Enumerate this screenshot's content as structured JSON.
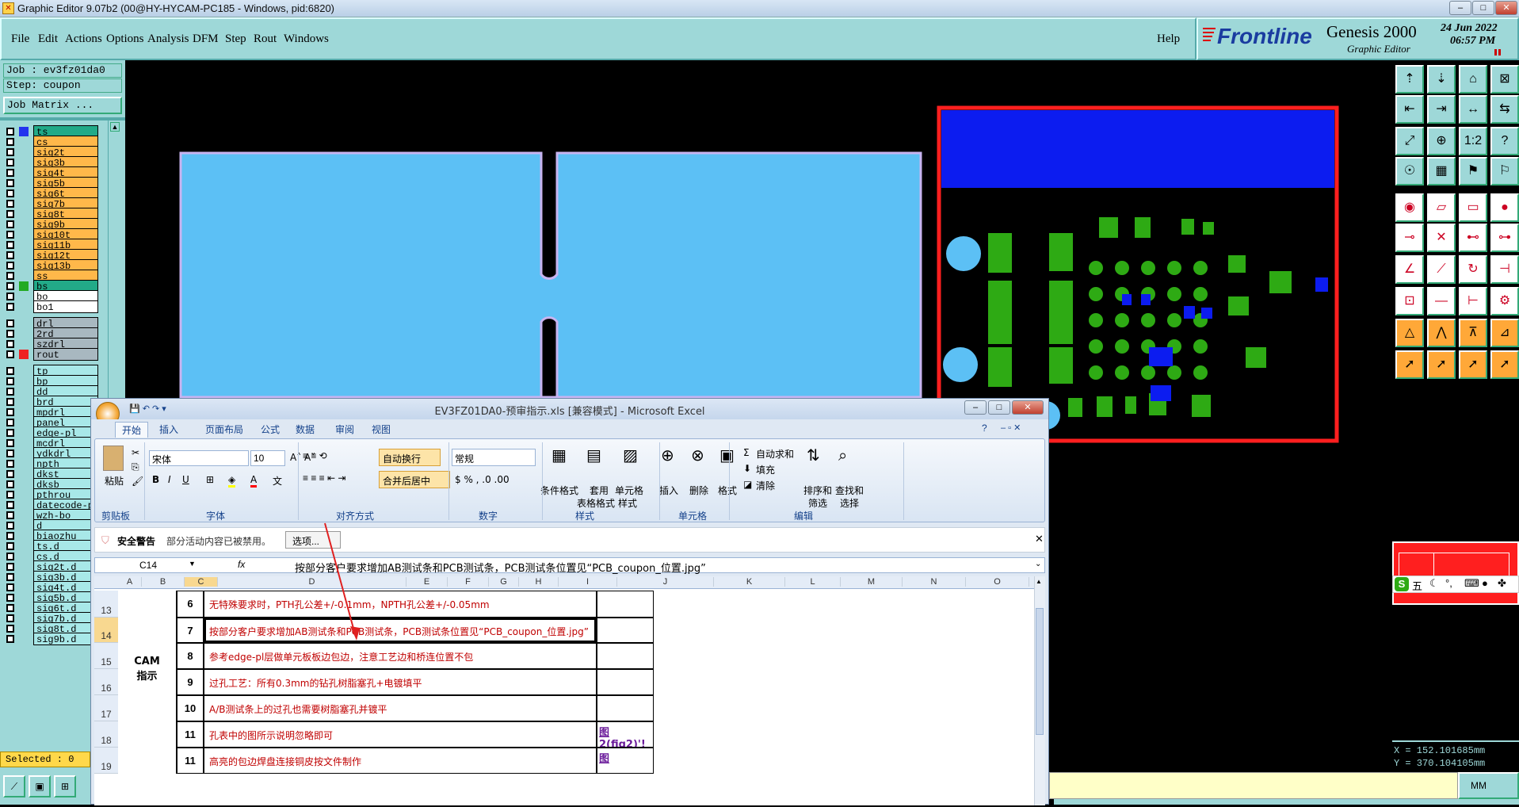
{
  "window": {
    "title": "Graphic Editor 9.07b2 (00@HY-HYCAM-PC185 - Windows, pid:6820)"
  },
  "menu": {
    "items": [
      "File",
      "Edit",
      "Actions",
      "Options",
      "Analysis",
      "DFM",
      "Step",
      "Rout",
      "Windows"
    ],
    "help": "Help"
  },
  "logo": {
    "brand": "Frontline",
    "product": "Genesis 2000",
    "sub": "Graphic Editor",
    "date": "24 Jun 2022",
    "time": "06:57 PM"
  },
  "job": {
    "job_label": "Job : ev3fz01da0",
    "step_label": "Step: coupon",
    "matrix_button": "Job Matrix ..."
  },
  "layers": [
    {
      "name": "ts",
      "color": "#2233ee",
      "bg": "#22aa88"
    },
    {
      "name": "cs",
      "color": "",
      "bg": "#ffb84a"
    },
    {
      "name": "sig2t",
      "color": "",
      "bg": "#ffb84a"
    },
    {
      "name": "sig3b",
      "color": "",
      "bg": "#ffb84a"
    },
    {
      "name": "sig4t",
      "color": "",
      "bg": "#ffb84a"
    },
    {
      "name": "sig5b",
      "color": "",
      "bg": "#ffb84a"
    },
    {
      "name": "sig6t",
      "color": "",
      "bg": "#ffb84a"
    },
    {
      "name": "sig7b",
      "color": "",
      "bg": "#ffb84a"
    },
    {
      "name": "sig8t",
      "color": "",
      "bg": "#ffb84a"
    },
    {
      "name": "sig9b",
      "color": "",
      "bg": "#ffb84a"
    },
    {
      "name": "sig10t",
      "color": "",
      "bg": "#ffb84a"
    },
    {
      "name": "sig11b",
      "color": "",
      "bg": "#ffb84a"
    },
    {
      "name": "sig12t",
      "color": "",
      "bg": "#ffb84a"
    },
    {
      "name": "sig13b",
      "color": "",
      "bg": "#ffb84a"
    },
    {
      "name": "ss",
      "color": "",
      "bg": "#ffb84a"
    },
    {
      "name": "bs",
      "color": "#22aa22",
      "bg": "#22aa88"
    },
    {
      "name": "bo",
      "color": "",
      "bg": "#ffffff"
    },
    {
      "name": "bo1",
      "color": "",
      "bg": "#ffffff"
    },
    {
      "name": "drl",
      "color": "",
      "bg": "#a8b8c0"
    },
    {
      "name": "2rd",
      "color": "",
      "bg": "#a8b8c0"
    },
    {
      "name": "szdrl",
      "color": "",
      "bg": "#a8b8c0"
    },
    {
      "name": "rout",
      "color": "#ee2222",
      "bg": "#a8b8c0"
    },
    {
      "name": "tp",
      "color": "",
      "bg": "#a8e8e8"
    },
    {
      "name": "bp",
      "color": "",
      "bg": "#a8e8e8"
    },
    {
      "name": "dd",
      "color": "",
      "bg": "#a8e8e8"
    },
    {
      "name": "brd",
      "color": "",
      "bg": "#a8e8e8"
    },
    {
      "name": "mpdrl",
      "color": "",
      "bg": "#a8e8e8"
    },
    {
      "name": "panel",
      "color": "",
      "bg": "#a8e8e8"
    },
    {
      "name": "edge-pl",
      "color": "",
      "bg": "#a8e8e8"
    },
    {
      "name": "mcdrl",
      "color": "",
      "bg": "#a8e8e8"
    },
    {
      "name": "ydkdrl",
      "color": "",
      "bg": "#a8e8e8"
    },
    {
      "name": "npth",
      "color": "",
      "bg": "#a8e8e8"
    },
    {
      "name": "dkst",
      "color": "",
      "bg": "#a8e8e8"
    },
    {
      "name": "dksb",
      "color": "",
      "bg": "#a8e8e8"
    },
    {
      "name": "pthrou",
      "color": "",
      "bg": "#a8e8e8"
    },
    {
      "name": "datecode-p",
      "color": "",
      "bg": "#a8e8e8"
    },
    {
      "name": "wzh-bo",
      "color": "",
      "bg": "#a8e8e8"
    },
    {
      "name": "d",
      "color": "",
      "bg": "#a8e8e8"
    },
    {
      "name": "biaozhu",
      "color": "",
      "bg": "#a8e8e8"
    },
    {
      "name": "ts.d",
      "color": "",
      "bg": "#a8e8e8"
    },
    {
      "name": "cs.d",
      "color": "",
      "bg": "#a8e8e8"
    },
    {
      "name": "sig2t.d",
      "color": "",
      "bg": "#a8e8e8"
    },
    {
      "name": "sig3b.d",
      "color": "",
      "bg": "#a8e8e8"
    },
    {
      "name": "sig4t.d",
      "color": "",
      "bg": "#a8e8e8"
    },
    {
      "name": "sig5b.d",
      "color": "",
      "bg": "#a8e8e8"
    },
    {
      "name": "sig6t.d",
      "color": "",
      "bg": "#a8e8e8"
    },
    {
      "name": "sig7b.d",
      "color": "",
      "bg": "#a8e8e8"
    },
    {
      "name": "sig8t.d",
      "color": "",
      "bg": "#a8e8e8"
    },
    {
      "name": "sig9b.d",
      "color": "",
      "bg": "#a8e8e8"
    }
  ],
  "status": {
    "selected": "Selected : 0",
    "units": "MM",
    "coord_x": "X = 152.101685mm",
    "coord_y": "Y = 370.104105mm"
  },
  "ime": {
    "label": "五"
  },
  "excel": {
    "title": "EV3FZ01DA0-预审指示.xls [兼容模式] - Microsoft Excel",
    "tabs": [
      "开始",
      "插入",
      "页面布局",
      "公式",
      "数据",
      "审阅",
      "视图"
    ],
    "font_name": "宋体",
    "font_size": "10",
    "number_format": "常规",
    "groups": [
      "剪贴板",
      "字体",
      "对齐方式",
      "数字",
      "样式",
      "单元格",
      "编辑"
    ],
    "buttons": {
      "paste": "粘贴",
      "wrap": "自动换行",
      "merge": "合并后居中",
      "cond_format": "条件格式",
      "table_format_1": "套用",
      "table_format_2": "表格格式",
      "cell_style_1": "单元格",
      "cell_style_2": "样式",
      "insert": "插入",
      "delete": "删除",
      "format": "格式",
      "autosum": "自动求和",
      "fill": "填充",
      "clear": "清除",
      "sort_1": "排序和",
      "sort_2": "筛选",
      "find_1": "查找和",
      "find_2": "选择"
    },
    "security": {
      "label": "安全警告",
      "message": "部分活动内容已被禁用。",
      "options": "选项..."
    },
    "name_box": "C14",
    "formula": "按部分客户要求增加AB测试条和PCB测试条，PCB测试条位置见“PCB_coupon_位置.jpg”",
    "columns": [
      "A",
      "B",
      "C",
      "D",
      "E",
      "F",
      "G",
      "H",
      "I",
      "J",
      "K",
      "L",
      "M",
      "N",
      "O"
    ],
    "merged_label": "CAM\n指示",
    "rows": [
      {
        "row": "13",
        "num": "6",
        "text": "无特殊要求时，PTH孔公差+/-0.1mm，NPTH孔公差+/-0.05mm",
        "j": ""
      },
      {
        "row": "14",
        "num": "7",
        "text": "按部分客户要求增加AB测试条和PCB测试条，PCB测试条位置见“PCB_coupon_位置.jpg”",
        "j": ""
      },
      {
        "row": "15",
        "num": "8",
        "text": "参考edge-pl层做单元板板边包边，注意工艺边和桥连位置不包",
        "j": ""
      },
      {
        "row": "16",
        "num": "9",
        "text": "过孔工艺：所有0.3mm的钻孔树脂塞孔+电镀填平",
        "j": ""
      },
      {
        "row": "17",
        "num": "10",
        "text": "A/B测试条上的过孔也需要树脂塞孔并镀平",
        "j": ""
      },
      {
        "row": "18",
        "num": "11",
        "text": "孔表中的图所示说明忽略即可",
        "j": "图2(fig2)'!"
      },
      {
        "row": "19",
        "num": "11",
        "text": "高亮的包边焊盘连接铜皮按文件制作",
        "j": "图"
      }
    ]
  }
}
